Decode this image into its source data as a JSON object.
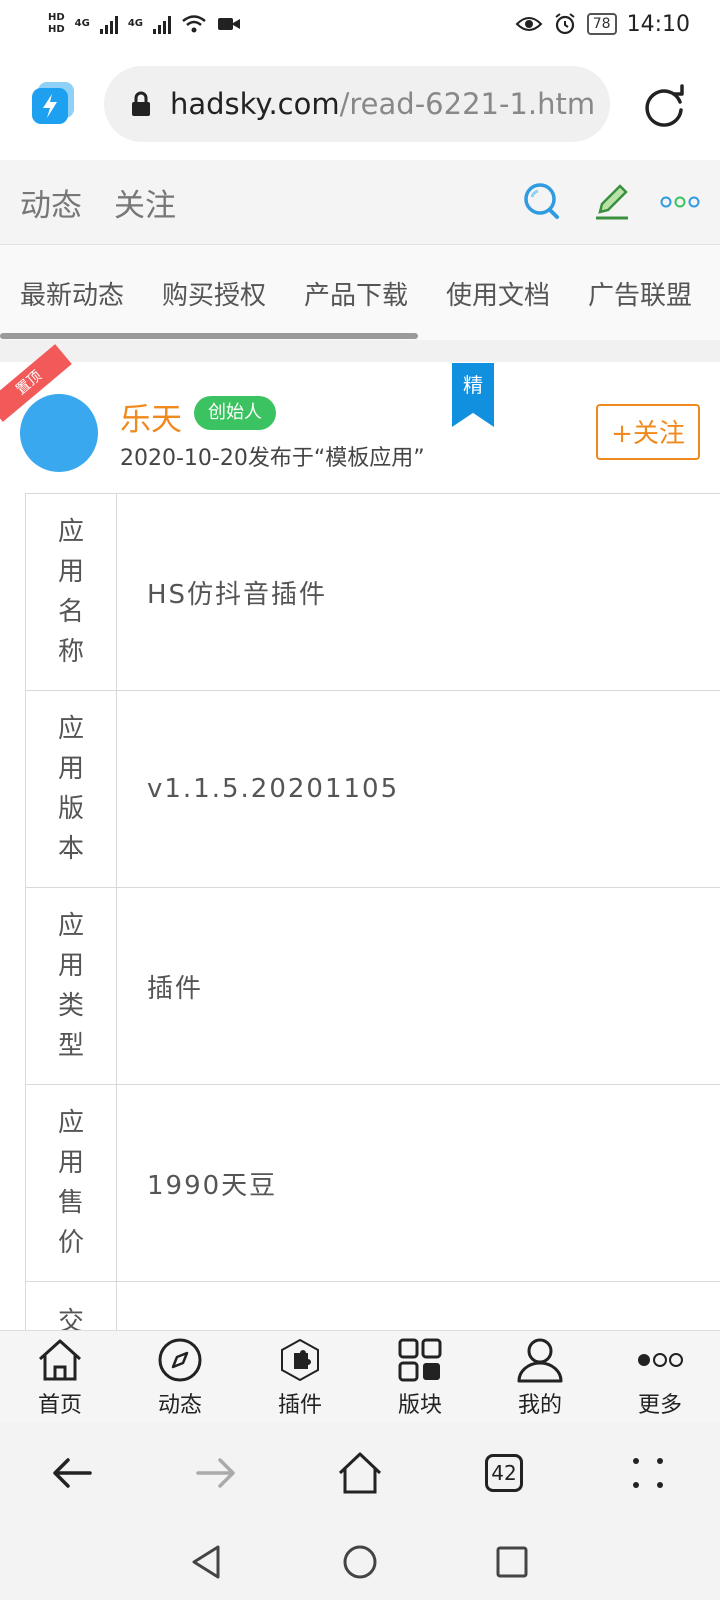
{
  "status_bar": {
    "hd1": "HD",
    "hd2": "HD",
    "net1": "4G",
    "net2": "4G",
    "battery": "78",
    "time": "14:10"
  },
  "browser": {
    "url_host": "hadsky.com",
    "url_path": "/read-6221-1.htm",
    "tab_count": "42"
  },
  "site_header": {
    "tabs": [
      "动态",
      "关注"
    ]
  },
  "nav": {
    "items": [
      "最新动态",
      "购买授权",
      "产品下载",
      "使用文档",
      "广告联盟"
    ]
  },
  "post": {
    "pin_label": "置顶",
    "essence_label": "精",
    "author": "乐天",
    "badge": "创始人",
    "meta": "2020-10-20发布于“模板应用”",
    "follow_label": "+关注"
  },
  "table": {
    "rows": [
      {
        "label": [
          "应",
          "用",
          "名",
          "称"
        ],
        "value": "HS仿抖音插件"
      },
      {
        "label": [
          "应",
          "用",
          "版",
          "本"
        ],
        "value": "v1.1.5.20201105"
      },
      {
        "label": [
          "应",
          "用",
          "类",
          "型"
        ],
        "value": "插件"
      },
      {
        "label": [
          "应",
          "用",
          "售",
          "价"
        ],
        "value": "1990天豆"
      },
      {
        "label": [
          "交"
        ],
        "value": ""
      }
    ]
  },
  "app_nav": {
    "items": [
      "首页",
      "动态",
      "插件",
      "版块",
      "我的",
      "更多"
    ]
  },
  "colors": {
    "accent_orange": "#f0891e",
    "badge_green": "#3cc361",
    "essence_blue": "#1290e0",
    "avatar_blue": "#3aa8ef",
    "pin_red": "#f25a5a"
  }
}
